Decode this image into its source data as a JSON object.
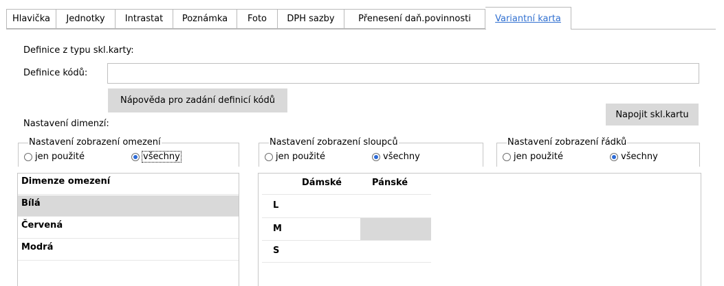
{
  "tabs": [
    {
      "label": "Hlavička"
    },
    {
      "label": "Jednotky"
    },
    {
      "label": "Intrastat"
    },
    {
      "label": "Poznámka"
    },
    {
      "label": "Foto"
    },
    {
      "label": "DPH sazby"
    },
    {
      "label": "Přenesení daň.povinnosti"
    },
    {
      "label": "Variantní karta",
      "active": true
    }
  ],
  "form": {
    "definice_z_typu_label": "Definice z typu skl.karty:",
    "definice_kodu_label": "Definice kódů:",
    "definice_kodu_value": "",
    "napoveda_button": "Nápověda pro zadání definicí kódů",
    "napojit_button": "Napojit skl.kartu",
    "nastaveni_dimenzi_label": "Nastavení dimenzí:"
  },
  "groups": {
    "omezeni": {
      "title": "Nastavení zobrazení omezení",
      "option_used": "jen použité",
      "option_all": "všechny",
      "selected": "all"
    },
    "sloupcu": {
      "title": "Nastavení zobrazení sloupců",
      "option_used": "jen použité",
      "option_all": "všechny",
      "selected": "all"
    },
    "radku": {
      "title": "Nastavení zobrazení řádků",
      "option_used": "jen použité",
      "option_all": "všechny",
      "selected": "all"
    }
  },
  "restriction_list": {
    "header": "Dimenze omezení",
    "items": [
      "Bílá",
      "Červená",
      "Modrá"
    ],
    "selected_index": 0
  },
  "matrix": {
    "columns": [
      "Dámské",
      "Pánské"
    ],
    "rows": [
      "L",
      "M",
      "S"
    ]
  },
  "colors": {
    "accent": "#2f6fd0",
    "button_bg": "#d9d9d9",
    "border": "#c6c6c6",
    "selected_row": "#d9d9d9"
  }
}
